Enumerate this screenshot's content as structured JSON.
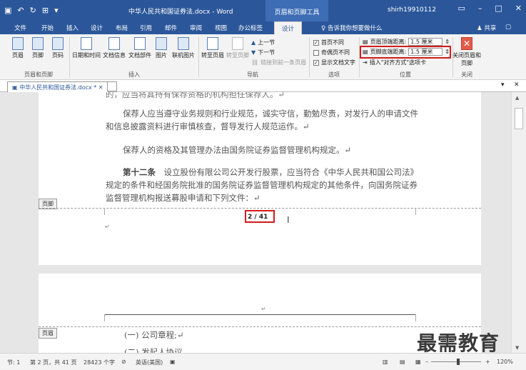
{
  "titlebar": {
    "title": "中华人民共和国证券法.docx - Word",
    "context_tools": "页眉和页脚工具",
    "user": "shirh19910112"
  },
  "tabs": [
    "文件",
    "开始",
    "插入",
    "设计",
    "布局",
    "引用",
    "邮件",
    "审阅",
    "视图",
    "办公标签",
    "设计"
  ],
  "active_tab_index": 10,
  "search_placeholder": "告诉我你想要做什么",
  "share_label": "共享",
  "ribbon": {
    "hf_group": {
      "label": "页眉和页脚",
      "buttons": [
        "页眉",
        "页脚",
        "页码"
      ]
    },
    "insert_group": {
      "label": "插入",
      "buttons": [
        "日期和时间",
        "文档信息",
        "文档部件",
        "图片",
        "联机图片"
      ]
    },
    "nav_group": {
      "label": "导航",
      "buttons": [
        "转至页眉",
        "转至页脚"
      ],
      "small": [
        "上一节",
        "下一节",
        "链接到前一条页眉"
      ]
    },
    "options_group": {
      "label": "选项",
      "items": [
        {
          "label": "首页不同",
          "checked": true
        },
        {
          "label": "奇偶页不同",
          "checked": false
        },
        {
          "label": "显示文档文字",
          "checked": true
        }
      ]
    },
    "position_group": {
      "label": "位置",
      "header_distance_label": "页眉顶端距离:",
      "header_distance_value": "1.5 厘米",
      "footer_distance_label": "页脚底端距离:",
      "footer_distance_value": "1.5 厘米",
      "insert_align_tab": "插入\"对齐方式\"选项卡"
    },
    "close_group": {
      "label": "关闭",
      "button": "关闭页眉和页脚"
    }
  },
  "document_tab": "中华人民共和国证券法.docx *",
  "document": {
    "partial_top": "的，应当将其持有保荐资格的机构担任保荐人。↵",
    "para1": "保荐人应当遵守业务规则和行业规范，诚实守信，勤勉尽责，对发行人的申请文件和信息披露资料进行审慎核查，督导发行人规范运作。↵",
    "para2": "保荐人的资格及其管理办法由国务院证券监督管理机构规定。↵",
    "para3_lead": "第十二条",
    "para3_rest": "　设立股份有限公司公开发行股票，应当符合《中华人民共和国公司法》规定的条件和经国务院批准的国务院证券监督管理机构规定的其他条件，向国务院证券监督管理机构报送募股申请和下列文件：↵",
    "footer_tag": "页脚",
    "page_number": "2 / 41",
    "header_tag": "页眉",
    "para4": "(一) 公司章程;↵",
    "para5": "(二) 发起人协议"
  },
  "statusbar": {
    "section": "节: 1",
    "page": "第 2 页，共 41 页",
    "words": "28423 个字",
    "language": "英语(美国)",
    "zoom": "120%"
  },
  "watermark": "最需教育"
}
